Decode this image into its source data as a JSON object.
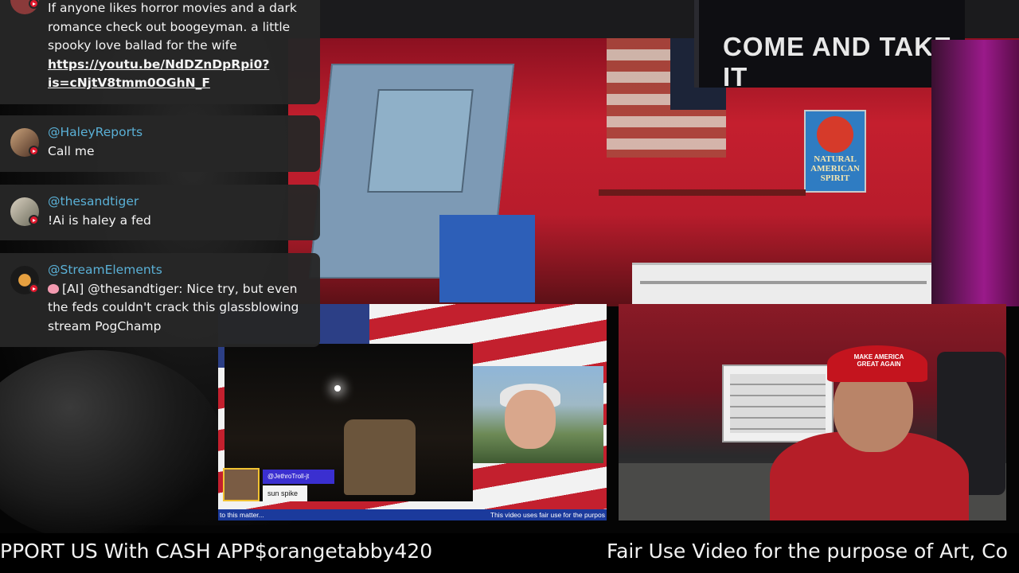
{
  "chat": {
    "messages": [
      {
        "username": "",
        "text": "If anyone likes horror movies and a dark romance check out boogeyman. a little spooky love ballad for the wife",
        "link": "https://youtu.be/NdDZnDpRpi0?is=cNjtV8tmm0OGhN_F",
        "avatar": "horror-avatar",
        "platform_badge": "youtube-icon"
      },
      {
        "username": "@HaleyReports",
        "text": "Call me",
        "avatar": "haley-avatar",
        "platform_badge": "youtube-icon"
      },
      {
        "username": "@thesandtiger",
        "text": "!Ai is haley a fed",
        "avatar": "tiger-avatar",
        "platform_badge": "youtube-icon"
      },
      {
        "username": "@StreamElements",
        "prefix": "[AI] @thesandtiger: Nice try, but even the feds couldn't crack this glassblowing stream PogChamp",
        "avatar": "streamelements-avatar",
        "platform_badge": "youtube-icon",
        "emoji": "brain-icon"
      }
    ]
  },
  "video": {
    "banner_text": "COME AND TAKE IT",
    "sign_text": "NATURAL AMERICAN SPIRIT",
    "hat_text": "MAKE AMERICA GREAT AGAIN"
  },
  "pip_left": {
    "chat_user": "@JethroTroll-jt",
    "chat_message": "sun spike",
    "ticker_left": "to this matter...",
    "ticker_right": "This video uses fair use for the purpos"
  },
  "bottom_ticker": {
    "left": "PPORT US With CASH APP$orangetabby420",
    "right": "Fair Use Video for the purpose of Art, Co"
  },
  "colors": {
    "chat_bg": "#262626",
    "username": "#5ab0d6",
    "youtube_red": "#e0182d",
    "ticker_bg": "#000000"
  }
}
